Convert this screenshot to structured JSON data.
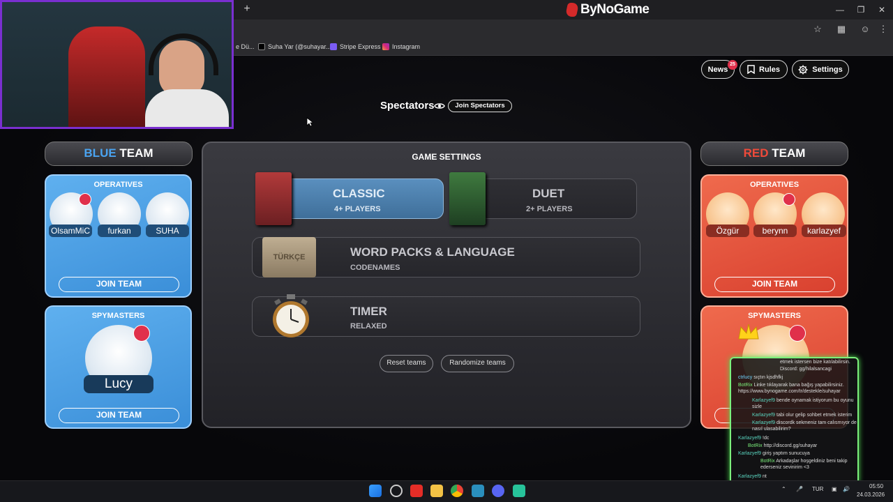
{
  "browser": {
    "brand": "ByNoGame",
    "new_tab": "+",
    "bookmarks": [
      "e Dü...",
      "Suha Yar (@suhayar...",
      "Stripe Express",
      "Instagram"
    ]
  },
  "topbar": {
    "news_label": "News",
    "news_count": "25",
    "rules_label": "Rules",
    "settings_label": "Settings"
  },
  "spectators": {
    "title": "Spectators",
    "join_label": "Join Spectators"
  },
  "blue_team": {
    "title_colored": "BLUE",
    "title_rest": "TEAM",
    "operatives_label": "OPERATIVES",
    "operatives": [
      "OlsamMiC",
      "furkan",
      "SUHA"
    ],
    "join_operatives": "JOIN TEAM",
    "spymasters_label": "SPYMASTERS",
    "spymaster": "Lucy",
    "join_spymasters": "JOIN TEAM"
  },
  "red_team": {
    "title_colored": "RED",
    "title_rest": "TEAM",
    "operatives_label": "OPERATIVES",
    "operatives": [
      "Özgür",
      "berynn",
      "karlazyef"
    ],
    "join_operatives": "JOIN TEAM",
    "spymasters_label": "SPYMASTERS"
  },
  "game_settings": {
    "title": "GAME SETTINGS",
    "classic": {
      "title": "CLASSIC",
      "sub": "4+ PLAYERS",
      "selected": true
    },
    "duet": {
      "title": "DUET",
      "sub": "2+ PLAYERS"
    },
    "wordpacks": {
      "title": "WORD PACKS & LANGUAGE",
      "sub": "CODENAMES",
      "box_label": "TÜRKÇE"
    },
    "timer": {
      "title": "TIMER",
      "sub": "RELAXED"
    },
    "reset_label": "Reset teams",
    "randomize_label": "Randomize teams"
  },
  "chat": [
    {
      "user": "",
      "text": "etmek istersen bize katılabilirsin."
    },
    {
      "user": "",
      "text": "Discord: gg/hilalsancagi"
    },
    {
      "user": "ctrlucy",
      "text": "sıçtın kjsdhfkj"
    },
    {
      "user": "BotRix",
      "text": "Linke tıklayarak bana bağış yapabilirsiniz. https://www.bynogame.com/tr/destekle/suhayar"
    },
    {
      "user": "Karlazyef9",
      "text": "bende oynamak istiyorum bu oyunu sizle"
    },
    {
      "user": "Karlazyef9",
      "text": "tabi olur gelip sohbet etmek isterim"
    },
    {
      "user": "Karlazyef9",
      "text": "discordk sekmeniz tam calısmıyor de nasıl ulasabilirim?"
    },
    {
      "user": "Karlazyef9",
      "text": "!dc"
    },
    {
      "user": "BotRix",
      "text": "http://discord.gg/suhayar"
    },
    {
      "user": "Karlazyef9",
      "text": "giriş yaptım sunucuya"
    },
    {
      "user": "BotRix",
      "text": "Arkadaşlar hoşgeldiniz beni takip ederseniz sevinirim <3"
    },
    {
      "user": "Karlazyef9",
      "text": "nt"
    }
  ],
  "taskbar": {
    "lang": "TUR",
    "time": "05:50",
    "date": "24.03.2026"
  },
  "colors": {
    "blue_accent": "#4aa3f0",
    "red_accent": "#ef4a3a",
    "chat_border": "#7cf07c"
  }
}
